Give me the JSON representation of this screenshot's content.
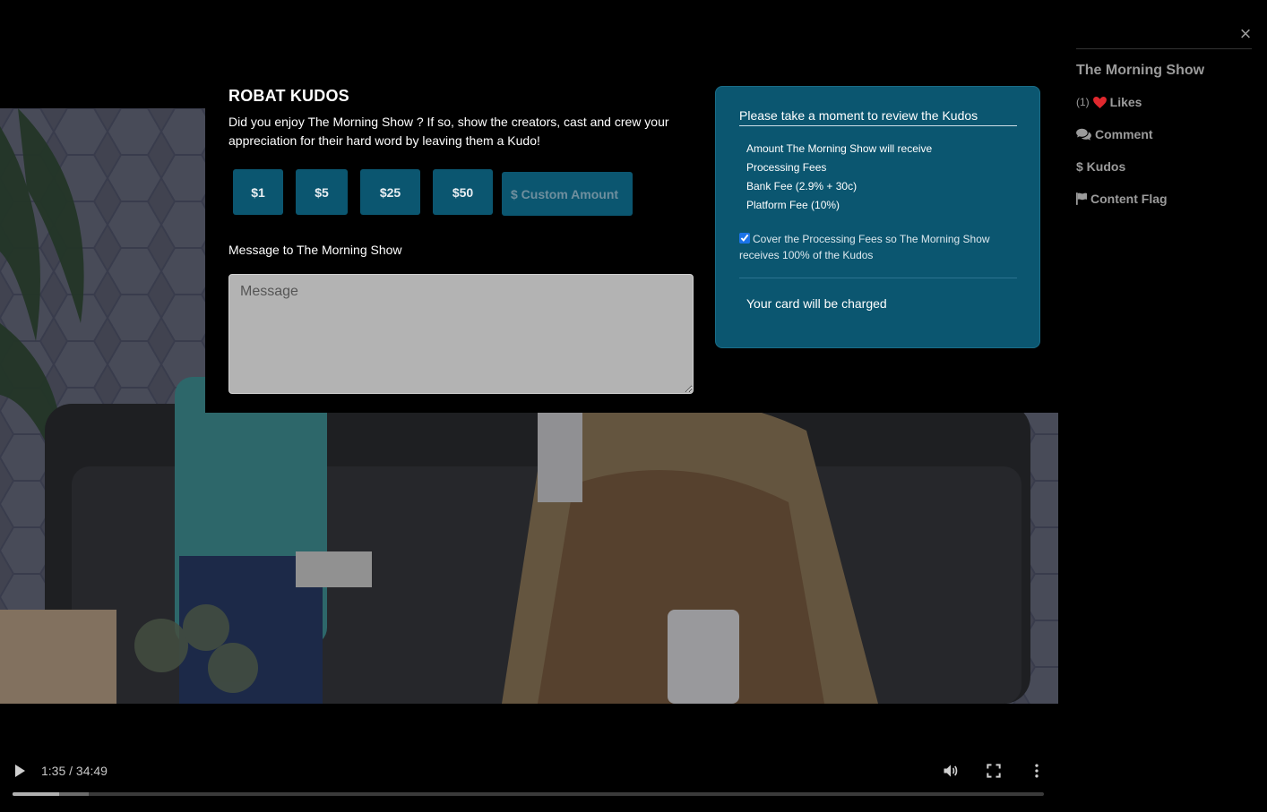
{
  "kudos": {
    "title": "ROBAT KUDOS",
    "description": "Did you enjoy The Morning Show ? If so, show the creators, cast and crew your appreciation for their hard word by leaving them a Kudo!",
    "amounts": [
      "$1",
      "$5",
      "$25",
      "$50"
    ],
    "custom_amount_placeholder": "$ Custom Amount",
    "message_label": "Message to The Morning Show",
    "message_placeholder": "Message"
  },
  "review": {
    "title": "Please take a moment to review the Kudos",
    "lines": [
      "Amount The Morning Show will receive",
      "Processing Fees",
      "Bank Fee (2.9% + 30c)",
      "Platform Fee (10%)"
    ],
    "cover_fees_label": "Cover the Processing Fees so The Morning Show receives 100% of the Kudos",
    "cover_fees_checked": true,
    "charged_label": "Your card will be charged"
  },
  "sidebar": {
    "close_glyph": "×",
    "title": "The Morning Show",
    "likes_count": "(1)",
    "likes_label": "Likes",
    "comment_label": "Comment",
    "kudos_label": "$ Kudos",
    "flag_label": "Content Flag",
    "icons": [
      "heart-icon",
      "comments-icon",
      "flag-icon"
    ]
  },
  "video": {
    "time": "1:35 / 34:49",
    "progress_fraction": 0.0455,
    "buffered_fraction": 0.074
  },
  "colors": {
    "accent": "#0b5670",
    "like_heart": "#e0282e",
    "muted_text": "#9b9b9b"
  }
}
